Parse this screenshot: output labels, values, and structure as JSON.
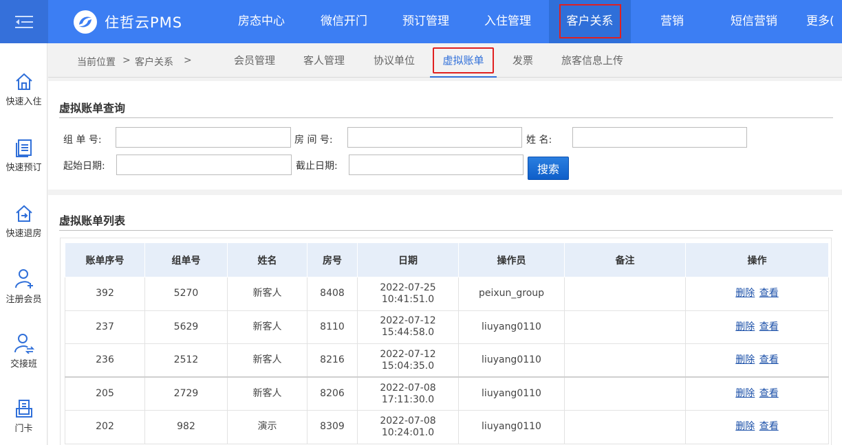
{
  "brand": {
    "name": "住哲云PMS"
  },
  "nav": [
    {
      "label": "房态中心"
    },
    {
      "label": "微信开门"
    },
    {
      "label": "预订管理"
    },
    {
      "label": "入住管理"
    },
    {
      "label": "客户关系"
    },
    {
      "label": "营销"
    },
    {
      "label": "短信营销"
    },
    {
      "label": "更多("
    }
  ],
  "sidebar": [
    {
      "label": "快速入住",
      "icon": "home-icon"
    },
    {
      "label": "快速预订",
      "icon": "booking-icon"
    },
    {
      "label": "快速退房",
      "icon": "checkout-icon"
    },
    {
      "label": "注册会员",
      "icon": "add-user-icon"
    },
    {
      "label": "交接班",
      "icon": "shift-icon"
    },
    {
      "label": "门卡",
      "icon": "card-icon"
    }
  ],
  "breadcrumb": {
    "current": "当前位置",
    "sep1": ">",
    "section": "客户关系",
    "sep2": ">"
  },
  "subtabs": [
    {
      "label": "会员管理"
    },
    {
      "label": "客人管理"
    },
    {
      "label": "协议单位"
    },
    {
      "label": "虚拟账单"
    },
    {
      "label": "发票"
    },
    {
      "label": "旅客信息上传"
    }
  ],
  "query": {
    "title": "虚拟账单查询",
    "group_no_label": "组 单 号:",
    "room_no_label": "房 间 号:",
    "name_label": "姓 名:",
    "start_date_label": "起始日期:",
    "end_date_label": "截止日期:",
    "group_no_value": "",
    "room_no_value": "",
    "name_value": "",
    "start_date_value": "",
    "end_date_value": "",
    "search_label": "搜索"
  },
  "list": {
    "title": "虚拟账单列表",
    "columns": [
      "账单序号",
      "组单号",
      "姓名",
      "房号",
      "日期",
      "操作员",
      "备注",
      "操作"
    ],
    "delete_label": "删除",
    "view_label": "查看",
    "rows": [
      {
        "id": "392",
        "group": "5270",
        "name": "新客人",
        "room": "8408",
        "date": "2022-07-25",
        "time": "10:41:51.0",
        "operator": "peixun_group",
        "note": ""
      },
      {
        "id": "237",
        "group": "5629",
        "name": "新客人",
        "room": "8110",
        "date": "2022-07-12",
        "time": "15:44:58.0",
        "operator": "liuyang0110",
        "note": ""
      },
      {
        "id": "236",
        "group": "2512",
        "name": "新客人",
        "room": "8216",
        "date": "2022-07-12",
        "time": "15:04:35.0",
        "operator": "liuyang0110",
        "note": ""
      },
      {
        "id": "205",
        "group": "2729",
        "name": "新客人",
        "room": "8206",
        "date": "2022-07-08",
        "time": "17:11:30.0",
        "operator": "liuyang0110",
        "note": ""
      },
      {
        "id": "202",
        "group": "982",
        "name": "演示",
        "room": "8309",
        "date": "2022-07-08",
        "time": "10:24:01.0",
        "operator": "liuyang0110",
        "note": ""
      }
    ]
  },
  "colors": {
    "topbar": "#3c7ef3",
    "accent": "#2f6fd9",
    "highlight_box": "#e02020",
    "header_row": "#e6eef9"
  }
}
